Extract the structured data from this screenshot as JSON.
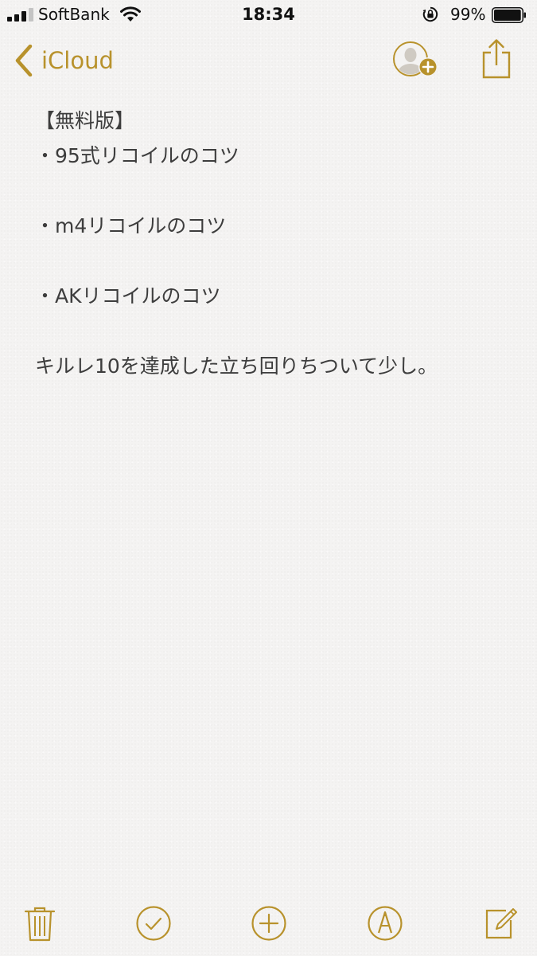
{
  "status_bar": {
    "carrier": "SoftBank",
    "time": "18:34",
    "battery_percent": "99%",
    "battery_level": 0.99,
    "signal_bars_filled": 3,
    "signal_bars_total": 4
  },
  "nav": {
    "back_label": "iCloud",
    "back_icon": "chevron-left-icon",
    "add_person_icon": "add-person-icon",
    "share_icon": "share-icon"
  },
  "note": {
    "lines": [
      "【無料版】",
      "・95式リコイルのコツ",
      "",
      "・m4リコイルのコツ",
      "",
      "・AKリコイルのコツ",
      "",
      "キルレ10を達成した立ち回りちついて少し。"
    ]
  },
  "toolbar": {
    "items": [
      "trash-icon",
      "checklist-icon",
      "add-icon",
      "sketch-icon",
      "compose-icon"
    ]
  },
  "colors": {
    "accent": "#b8922c",
    "background": "#f4f3f2",
    "text": "#3d3d3d",
    "status_text": "#111111"
  }
}
